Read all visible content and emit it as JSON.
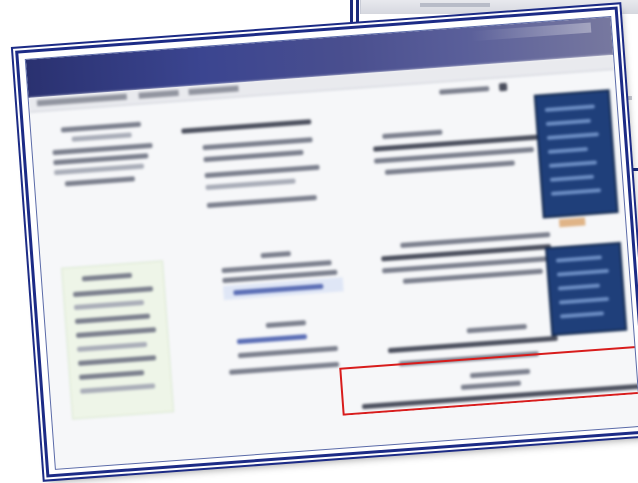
{
  "colors": {
    "frame_border": "#1c2b86",
    "titlebar_start": "#2a3170",
    "sidebar_bg": "#1f3f7a",
    "highlight_box": "#d81c1c"
  },
  "icons": [
    "screenshot-frame",
    "highlight-rectangle"
  ]
}
